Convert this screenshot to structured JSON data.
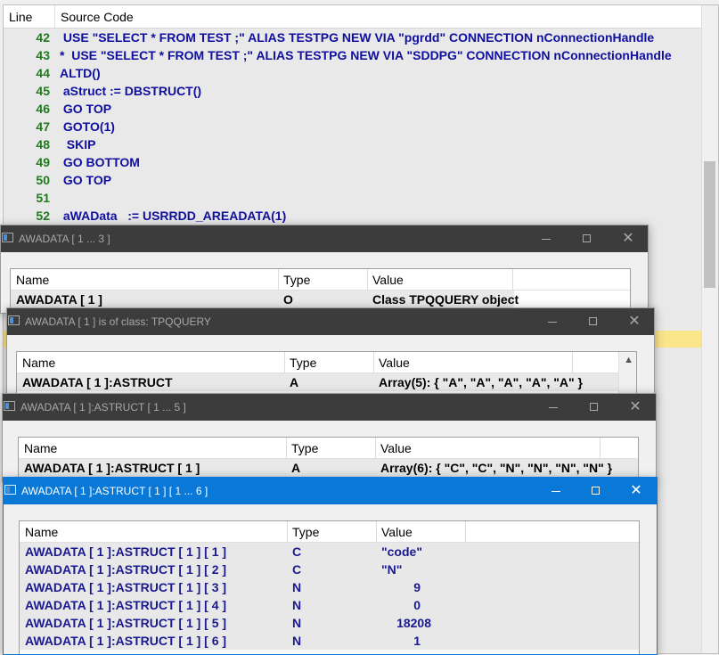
{
  "code_pane": {
    "header": {
      "line_label": "Line",
      "source_label": "Source Code"
    },
    "rows": [
      {
        "line": "42",
        "text": " USE \"SELECT * FROM TEST ;\" ALIAS TESTPG NEW VIA \"pgrdd\" CONNECTION nConnectionHandle"
      },
      {
        "line": "43",
        "text": "*  USE \"SELECT * FROM TEST ;\" ALIAS TESTPG NEW VIA \"SDDPG\" CONNECTION nConnectionHandle"
      },
      {
        "line": "44",
        "text": "ALTD()"
      },
      {
        "line": "45",
        "text": " aStruct := DBSTRUCT()"
      },
      {
        "line": "46",
        "text": " GO TOP"
      },
      {
        "line": "47",
        "text": " GOTO(1)"
      },
      {
        "line": "48",
        "text": "  SKIP"
      },
      {
        "line": "49",
        "text": " GO BOTTOM"
      },
      {
        "line": "50",
        "text": " GO TOP"
      },
      {
        "line": "51",
        "text": ""
      },
      {
        "line": "52",
        "text": " aWAData   := USRRDD_AREADATA(1)"
      }
    ]
  },
  "windows": [
    {
      "title": "AWADATA [ 1 ... 3 ]",
      "columns": [
        "Name",
        "Type",
        "Value"
      ],
      "rows": [
        {
          "name": "AWADATA [ 1 ]",
          "type": "O",
          "value": "Class TPQQUERY object"
        }
      ]
    },
    {
      "title": "AWADATA [ 1 ] is of class: TPQQUERY",
      "columns": [
        "Name",
        "Type",
        "Value"
      ],
      "rows": [
        {
          "name": "AWADATA [ 1 ]:ASTRUCT",
          "type": "A",
          "value": "Array(5): { \"A\", \"A\", \"A\", \"A\", \"A\" }"
        }
      ]
    },
    {
      "title": "AWADATA [ 1 ]:ASTRUCT [ 1 ... 5 ]",
      "columns": [
        "Name",
        "Type",
        "Value"
      ],
      "rows": [
        {
          "name": "AWADATA [ 1 ]:ASTRUCT [ 1 ]",
          "type": "A",
          "value": "Array(6): { \"C\", \"C\", \"N\", \"N\", \"N\", \"N\" }"
        }
      ]
    },
    {
      "title": "AWADATA [ 1 ]:ASTRUCT [ 1 ] [ 1 ... 6 ]",
      "columns": [
        "Name",
        "Type",
        "Value"
      ],
      "rows": [
        {
          "name": "AWADATA [ 1 ]:ASTRUCT [ 1 ] [ 1 ]",
          "type": "C",
          "value": "\"code\""
        },
        {
          "name": "AWADATA [ 1 ]:ASTRUCT [ 1 ] [ 2 ]",
          "type": "C",
          "value": "\"N\""
        },
        {
          "name": "AWADATA [ 1 ]:ASTRUCT [ 1 ] [ 3 ]",
          "type": "N",
          "value": "9"
        },
        {
          "name": "AWADATA [ 1 ]:ASTRUCT [ 1 ] [ 4 ]",
          "type": "N",
          "value": "0"
        },
        {
          "name": "AWADATA [ 1 ]:ASTRUCT [ 1 ] [ 5 ]",
          "type": "N",
          "value": "18208"
        },
        {
          "name": "AWADATA [ 1 ]:ASTRUCT [ 1 ] [ 6 ]",
          "type": "N",
          "value": "1"
        }
      ]
    }
  ],
  "window_controls": {
    "minimize_icon": "minimize-icon",
    "maximize_icon": "maximize-icon",
    "close_icon": "close-icon",
    "close_glyph": "✕"
  },
  "colors": {
    "active_titlebar": "#0a78d7",
    "inactive_titlebar": "#3c3c3c",
    "line_number": "#1e7b1e",
    "source_text": "#0f0fa0",
    "execution_highlight": "#fbe58a"
  }
}
